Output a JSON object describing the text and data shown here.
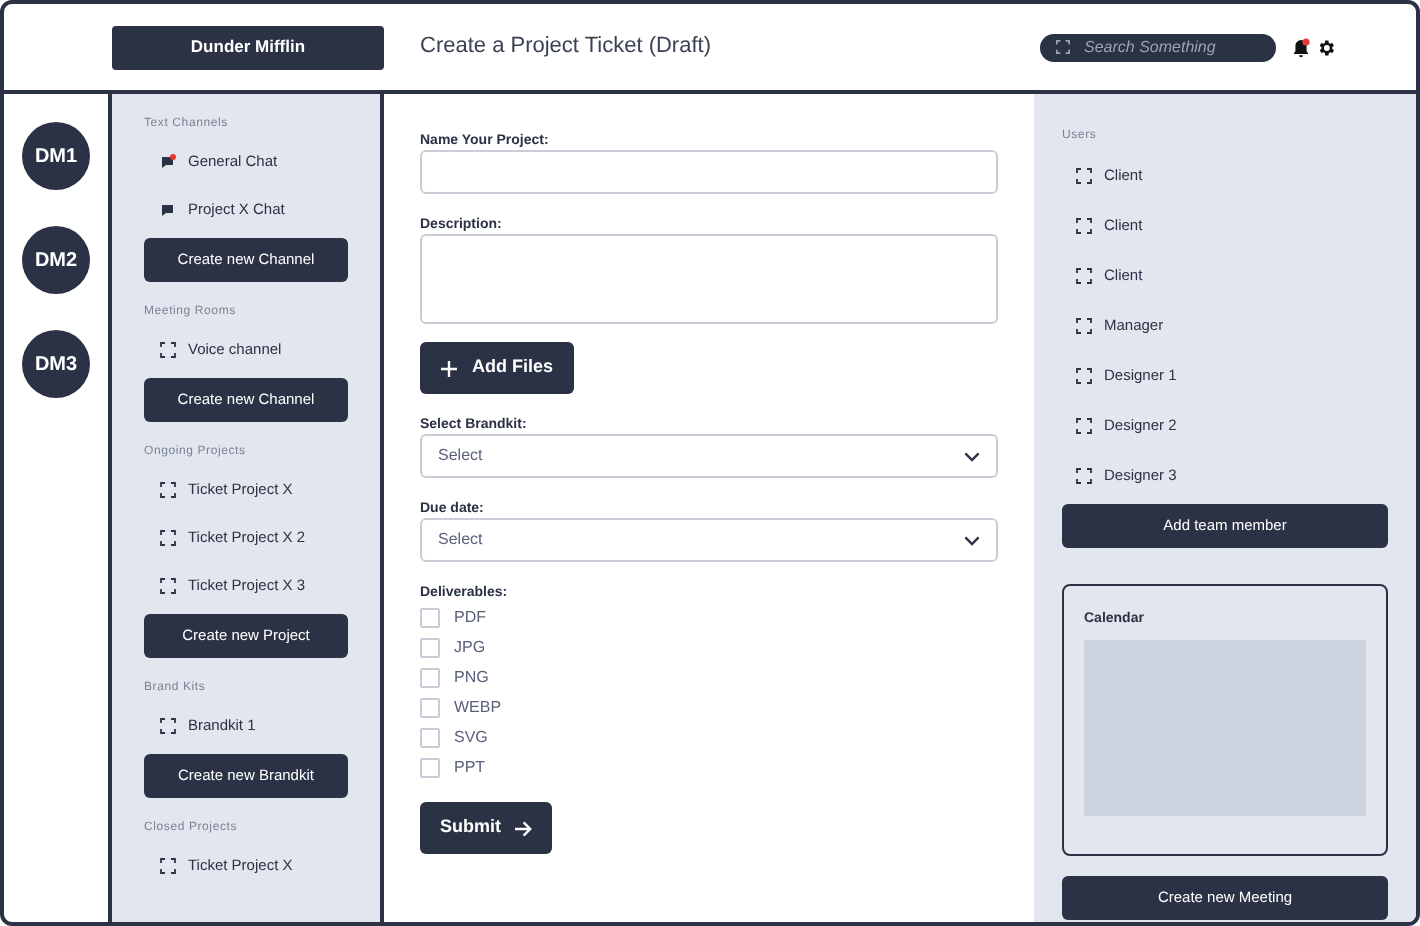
{
  "header": {
    "brand": "Dunder Mifflin",
    "title": "Create a Project Ticket (Draft)",
    "search": {
      "placeholder": "Search Something"
    },
    "notifications_unread": true
  },
  "dm_rail": [
    "DM1",
    "DM2",
    "DM3"
  ],
  "channels": [
    {
      "title": "Text Channels",
      "items": [
        {
          "label": "General Chat",
          "kind": "chat",
          "unread": true
        },
        {
          "label": "Project X Chat",
          "kind": "chat",
          "unread": false
        }
      ],
      "button": "Create new Channel"
    },
    {
      "title": "Meeting Rooms",
      "items": [
        {
          "label": "Voice channel",
          "kind": "placeholder"
        }
      ],
      "button": "Create new Channel"
    },
    {
      "title": "Ongoing Projects",
      "items": [
        {
          "label": "Ticket Project X",
          "kind": "placeholder"
        },
        {
          "label": "Ticket Project X 2",
          "kind": "placeholder"
        },
        {
          "label": "Ticket Project X 3",
          "kind": "placeholder"
        }
      ],
      "button": "Create new Project"
    },
    {
      "title": "Brand Kits",
      "items": [
        {
          "label": "Brandkit 1",
          "kind": "placeholder"
        }
      ],
      "button": "Create new Brandkit"
    },
    {
      "title": "Closed Projects",
      "items": [
        {
          "label": "Ticket Project X",
          "kind": "placeholder"
        }
      ]
    }
  ],
  "form": {
    "fields": [
      {
        "kind": "input",
        "label": "Name Your Project:"
      },
      {
        "kind": "textarea",
        "label": "Description:"
      },
      {
        "kind": "button",
        "label": "Add Files"
      },
      {
        "kind": "select",
        "label": "Select Brandkit:",
        "value": "Select"
      },
      {
        "kind": "select",
        "label": "Due date:",
        "value": "Select"
      }
    ],
    "deliverables": {
      "label": "Deliverables:",
      "options": [
        {
          "label": "PDF",
          "checked": false
        },
        {
          "label": "JPG",
          "checked": false
        },
        {
          "label": "PNG",
          "checked": false
        },
        {
          "label": "WEBP",
          "checked": false
        },
        {
          "label": "SVG",
          "checked": false
        },
        {
          "label": "PPT",
          "checked": false
        }
      ]
    },
    "submit": "Submit"
  },
  "users": {
    "title": "Users",
    "items": [
      "Client",
      "Client",
      "Client",
      "Manager",
      "Designer 1",
      "Designer 2",
      "Designer 3"
    ],
    "button": "Add team member"
  },
  "calendar": {
    "title": "Calendar"
  },
  "meeting_button": "Create new Meeting"
}
